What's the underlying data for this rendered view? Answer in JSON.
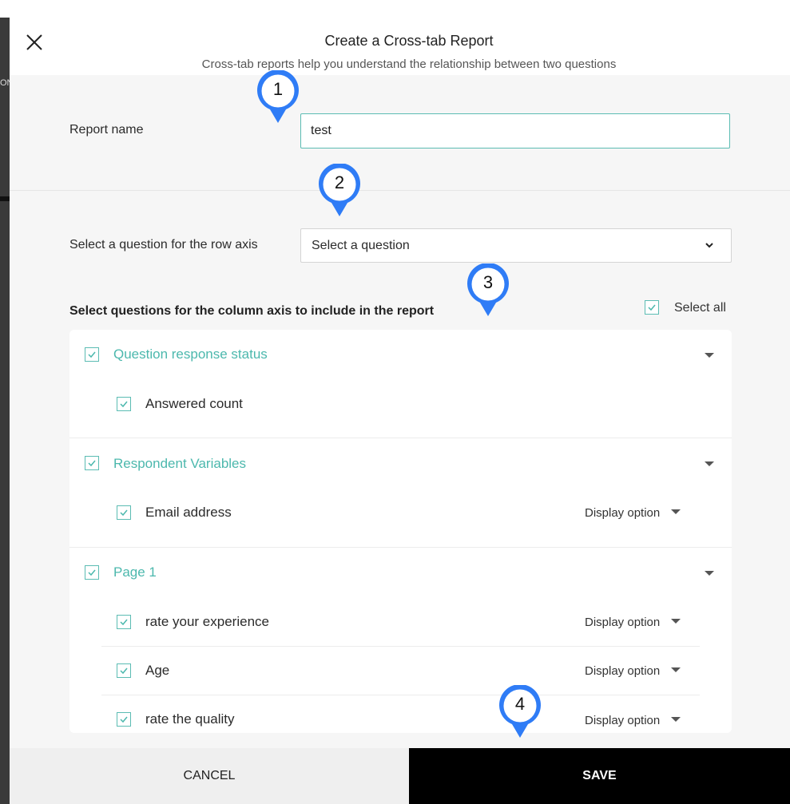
{
  "header": {
    "title": "Create a Cross-tab Report",
    "subtitle": "Cross-tab reports help you understand the relationship between two questions"
  },
  "left_fragment": "ON",
  "report_name": {
    "label": "Report name",
    "value": "test"
  },
  "row_axis": {
    "label": "Select a question for the row axis",
    "selected": "Select a question"
  },
  "column_axis": {
    "heading": "Select questions for the column axis to include in the report",
    "select_all_label": "Select all",
    "select_all_checked": true,
    "groups": [
      {
        "title": "Question response status",
        "checked": true,
        "items": [
          {
            "label": "Answered count",
            "checked": true,
            "display_option": ""
          }
        ]
      },
      {
        "title": "Respondent Variables",
        "checked": true,
        "items": [
          {
            "label": "Email address",
            "checked": true,
            "display_option": "Display option"
          }
        ]
      },
      {
        "title": "Page 1",
        "checked": true,
        "items": [
          {
            "label": "rate your experience",
            "checked": true,
            "display_option": "Display option"
          },
          {
            "label": "Age",
            "checked": true,
            "display_option": "Display option"
          },
          {
            "label": "rate the quality",
            "checked": true,
            "display_option": "Display option"
          }
        ]
      }
    ]
  },
  "footer": {
    "cancel_label": "CANCEL",
    "save_label": "SAVE"
  },
  "annotations": [
    "1",
    "2",
    "3",
    "4"
  ],
  "colors": {
    "accent_teal": "#4cb8ad",
    "pin_blue": "#2f7cf6",
    "save_bg": "#000000"
  }
}
